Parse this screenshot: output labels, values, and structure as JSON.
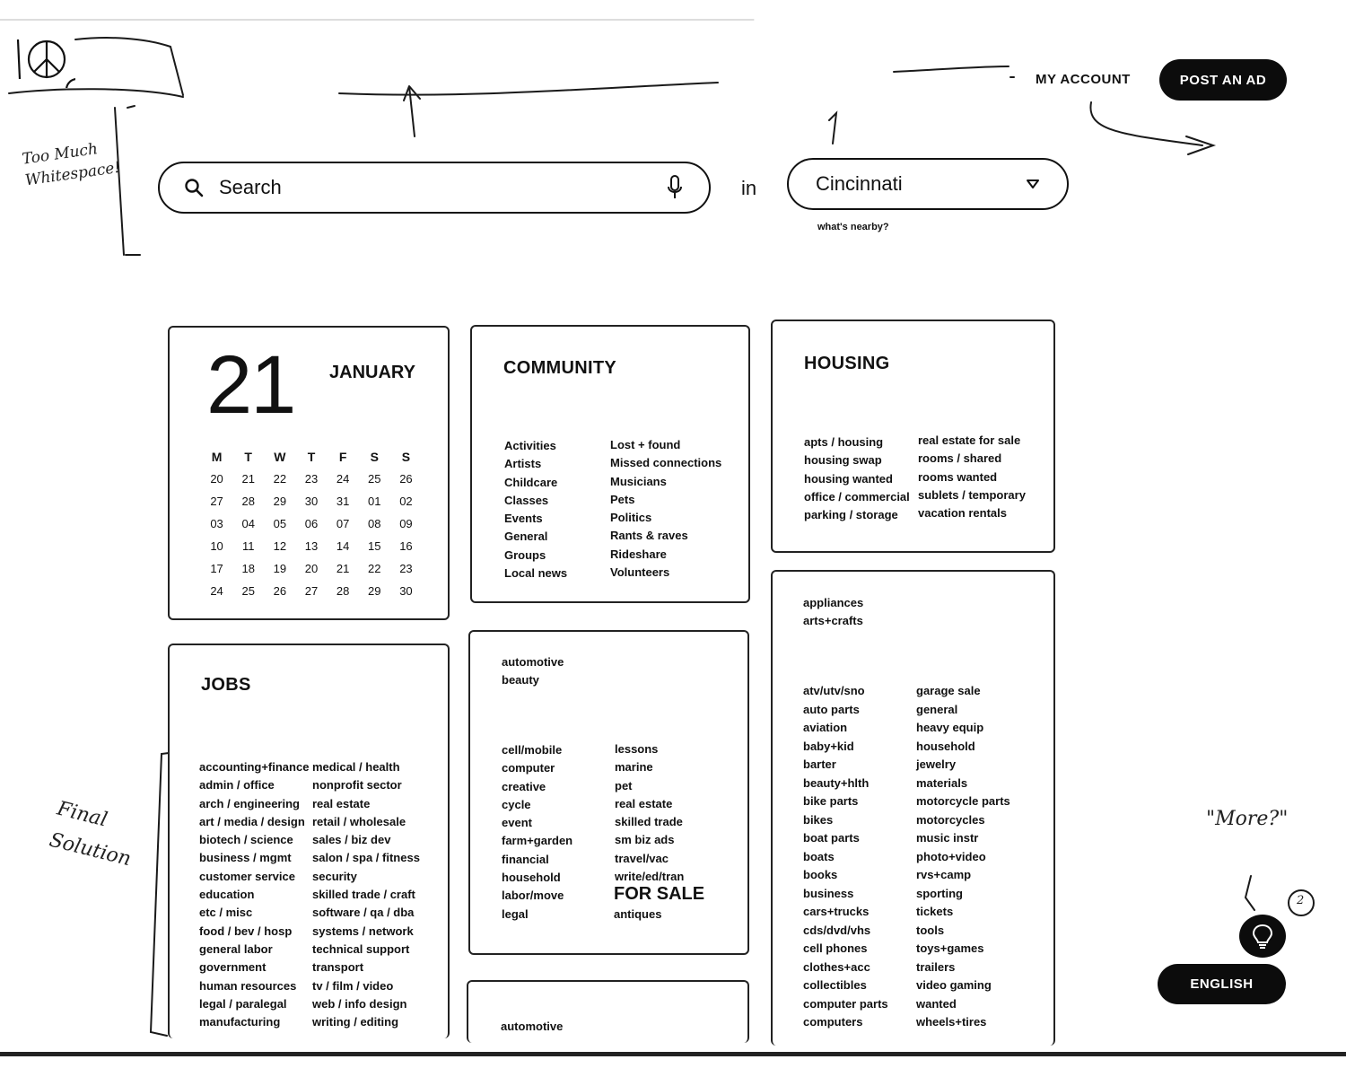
{
  "header": {
    "my_account": "MY ACCOUNT",
    "post_ad": "POST AN AD"
  },
  "search": {
    "placeholder": "Search",
    "in_label": "in",
    "city": "Cincinnati",
    "nearby": "what's nearby?"
  },
  "calendar": {
    "day": "21",
    "month": "JANUARY",
    "weekdays": [
      "M",
      "T",
      "W",
      "T",
      "F",
      "S",
      "S"
    ],
    "weeks": [
      [
        "20",
        "21",
        "22",
        "23",
        "24",
        "25",
        "26"
      ],
      [
        "27",
        "28",
        "29",
        "30",
        "31",
        "01",
        "02"
      ],
      [
        "03",
        "04",
        "05",
        "06",
        "07",
        "08",
        "09"
      ],
      [
        "10",
        "11",
        "12",
        "13",
        "14",
        "15",
        "16"
      ],
      [
        "17",
        "18",
        "19",
        "20",
        "21",
        "22",
        "23"
      ],
      [
        "24",
        "25",
        "26",
        "27",
        "28",
        "29",
        "30"
      ]
    ]
  },
  "community": {
    "title": "COMMUNITY",
    "col1": [
      "Activities",
      "Artists",
      "Childcare",
      "Classes",
      "Events",
      "General",
      "Groups",
      "Local news"
    ],
    "col2": [
      "Lost + found",
      "Missed connections",
      "Musicians",
      "Pets",
      "Politics",
      "Rants & raves",
      "Rideshare",
      "Volunteers"
    ]
  },
  "housing": {
    "title": "HOUSING",
    "col1": [
      "apts / housing",
      "housing swap",
      "housing wanted",
      "office / commercial",
      "parking / storage"
    ],
    "col2": [
      "real estate for sale",
      "rooms / shared",
      "rooms wanted",
      "sublets / temporary",
      "vacation rentals"
    ]
  },
  "jobs": {
    "title": "JOBS",
    "col1": [
      "accounting+finance",
      "admin / office",
      "arch / engineering",
      "art / media / design",
      "biotech / science",
      "business / mgmt",
      "customer service",
      "education",
      "etc / misc",
      "food / bev / hosp",
      "general labor",
      "government",
      "human resources",
      "legal / paralegal",
      "manufacturing"
    ],
    "col2": [
      "medical / health",
      "nonprofit sector",
      "real estate",
      "retail / wholesale",
      "sales / biz dev",
      "salon / spa / fitness",
      "security",
      "skilled trade / craft",
      "software / qa / dba",
      "systems / network",
      "technical support",
      "transport",
      "tv / film / video",
      "web / info design",
      "writing / editing"
    ]
  },
  "services": {
    "top": [
      "automotive",
      "beauty"
    ],
    "col1": [
      "cell/mobile",
      "computer",
      "creative",
      "cycle",
      "event",
      "farm+garden",
      "financial",
      "household",
      "labor/move",
      "legal"
    ],
    "col2": [
      "lessons",
      "marine",
      "pet",
      "real estate",
      "skilled trade",
      "sm biz ads",
      "travel/vac",
      "write/ed/tran"
    ],
    "for_sale": "FOR SALE",
    "after_sale": "antiques"
  },
  "bottom_card": {
    "item": "automotive"
  },
  "for_sale_list": {
    "top": [
      "appliances",
      "arts+crafts"
    ],
    "col1": [
      "atv/utv/sno",
      "auto parts",
      "aviation",
      "baby+kid",
      "barter",
      "beauty+hlth",
      "bike parts",
      "bikes",
      "boat parts",
      "boats",
      "books",
      "business",
      "cars+trucks",
      "cds/dvd/vhs",
      "cell phones",
      "clothes+acc",
      "collectibles",
      "computer parts",
      "computers"
    ],
    "col2": [
      "garage sale",
      "general",
      "heavy equip",
      "household",
      "jewelry",
      "materials",
      "motorcycle parts",
      "motorcycles",
      "music instr",
      "photo+video",
      "rvs+camp",
      "sporting",
      "tickets",
      "tools",
      "toys+games",
      "trailers",
      "video gaming",
      "wanted",
      "wheels+tires"
    ]
  },
  "footer": {
    "language": "ENGLISH"
  },
  "annotations": {
    "whitespace": "Too Much Whitespace!",
    "final": "Final Solution",
    "more": "\"More?\"",
    "circled_number": "2"
  }
}
